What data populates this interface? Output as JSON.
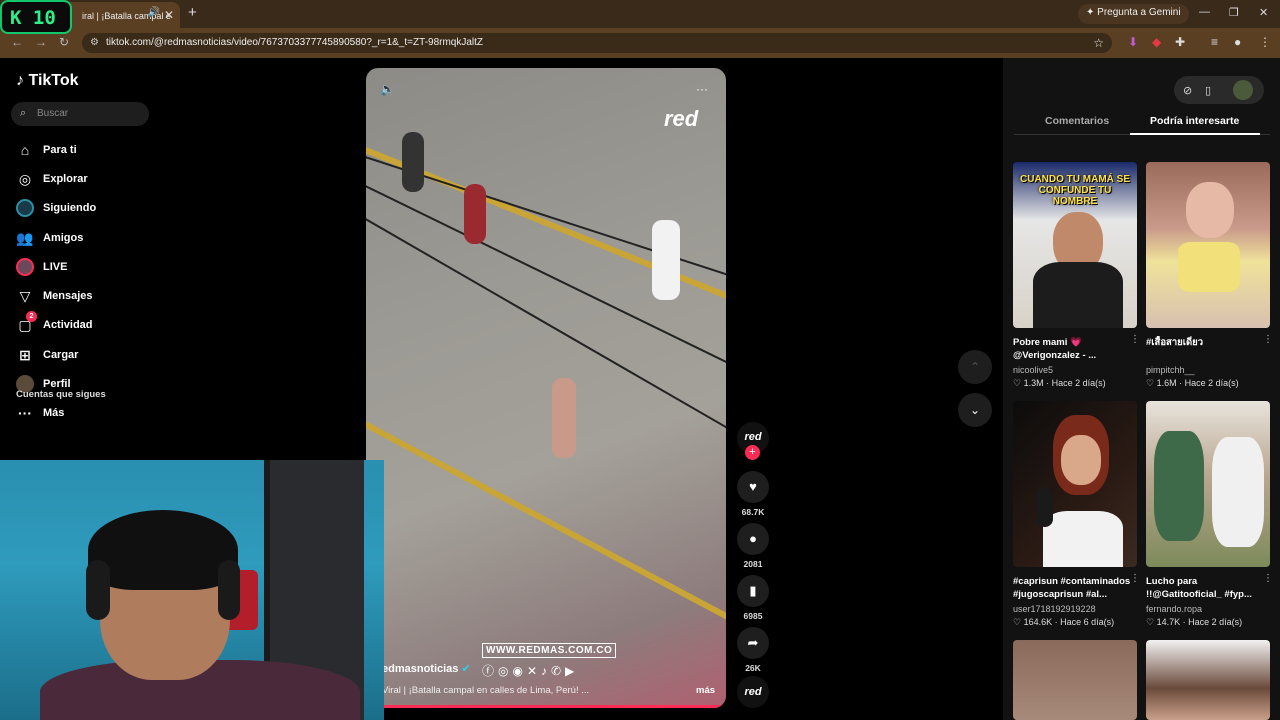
{
  "browser": {
    "badge": "K 10",
    "tab_title": "iral | ¡Batalla campal e",
    "gemini_label": "Pregunta a Gemini",
    "url": "tiktok.com/@redmasnoticias/video/7673703377745890580?_r=1&_t=ZT-98rmqkJaltZ"
  },
  "sidebar": {
    "logo": "TikTok",
    "search_placeholder": "Buscar",
    "items": [
      {
        "label": "Para ti",
        "icon": "home-icon"
      },
      {
        "label": "Explorar",
        "icon": "compass-icon"
      },
      {
        "label": "Siguiendo",
        "icon": "following-avatar"
      },
      {
        "label": "Amigos",
        "icon": "friends-icon"
      },
      {
        "label": "LIVE",
        "icon": "live-avatar"
      },
      {
        "label": "Mensajes",
        "icon": "messages-icon"
      },
      {
        "label": "Actividad",
        "icon": "activity-icon",
        "badge": "2"
      },
      {
        "label": "Cargar",
        "icon": "upload-icon"
      },
      {
        "label": "Perfil",
        "icon": "profile-avatar"
      },
      {
        "label": "Más",
        "icon": "more-icon"
      }
    ],
    "following_heading": "Cuentas que sigues"
  },
  "video": {
    "channel_logo": "red",
    "watermark": "WWW.REDMAS.COM.CO",
    "author": "edmasnoticias",
    "caption": "Viral | ¡Batalla campal en calles de Lima, Perú! ...",
    "more": "más",
    "progress": 0.99
  },
  "actions": {
    "avatar_label": "red",
    "likes": "68.7K",
    "comments": "2081",
    "saves": "6985",
    "shares": "26K",
    "sound_label": "red"
  },
  "right_panel": {
    "tabs": [
      "Comentarios",
      "Podría interesarte"
    ],
    "active_tab": 1,
    "cards": [
      {
        "overlay": "CUANDO TU MAMÁ SE CONFUNDE TU NOMBRE",
        "title": "Pobre mami 💗 @Verigonzalez - ...",
        "user": "nicoolive5",
        "likes": "1.3M",
        "time": "Hace 2 día(s)"
      },
      {
        "overlay": "",
        "title": "#เสื้อสายเดี่ยว",
        "user": "pimpitchh__",
        "likes": "1.6M",
        "time": "Hace 2 día(s)"
      },
      {
        "overlay": "",
        "title": "#caprisun #contaminados #jugoscaprisun #al...",
        "user": "user1718192919228",
        "likes": "164.6K",
        "time": "Hace 6 día(s)"
      },
      {
        "overlay": "",
        "title": "Lucho para !!@Gatitooficial_ #fyp...",
        "user": "fernando.ropa",
        "likes": "14.7K",
        "time": "Hace 2 día(s)"
      }
    ]
  },
  "colors": {
    "accent": "#fe2c55",
    "chrome_bg": "#5a3f22",
    "panel_bg": "#121212"
  }
}
